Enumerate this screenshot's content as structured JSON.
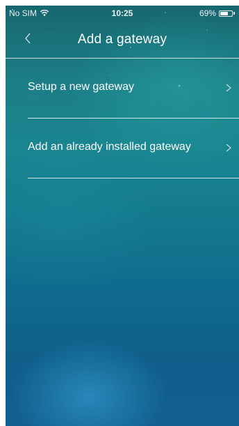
{
  "status_bar": {
    "carrier": "No SIM",
    "time": "10:25",
    "battery_percent": "69%",
    "battery_level": 0.69,
    "icons": [
      "wifi-icon",
      "battery-icon"
    ]
  },
  "nav": {
    "title": "Add a gateway",
    "back_icon": "chevron-left-icon"
  },
  "menu": {
    "items": [
      {
        "label": "Setup a new gateway",
        "icon": "chevron-right-icon"
      },
      {
        "label": "Add an already installed gateway",
        "icon": "chevron-right-icon"
      }
    ]
  },
  "colors": {
    "text": "#ffffff",
    "background_top": "#17666f",
    "background_bottom": "#125f92"
  }
}
